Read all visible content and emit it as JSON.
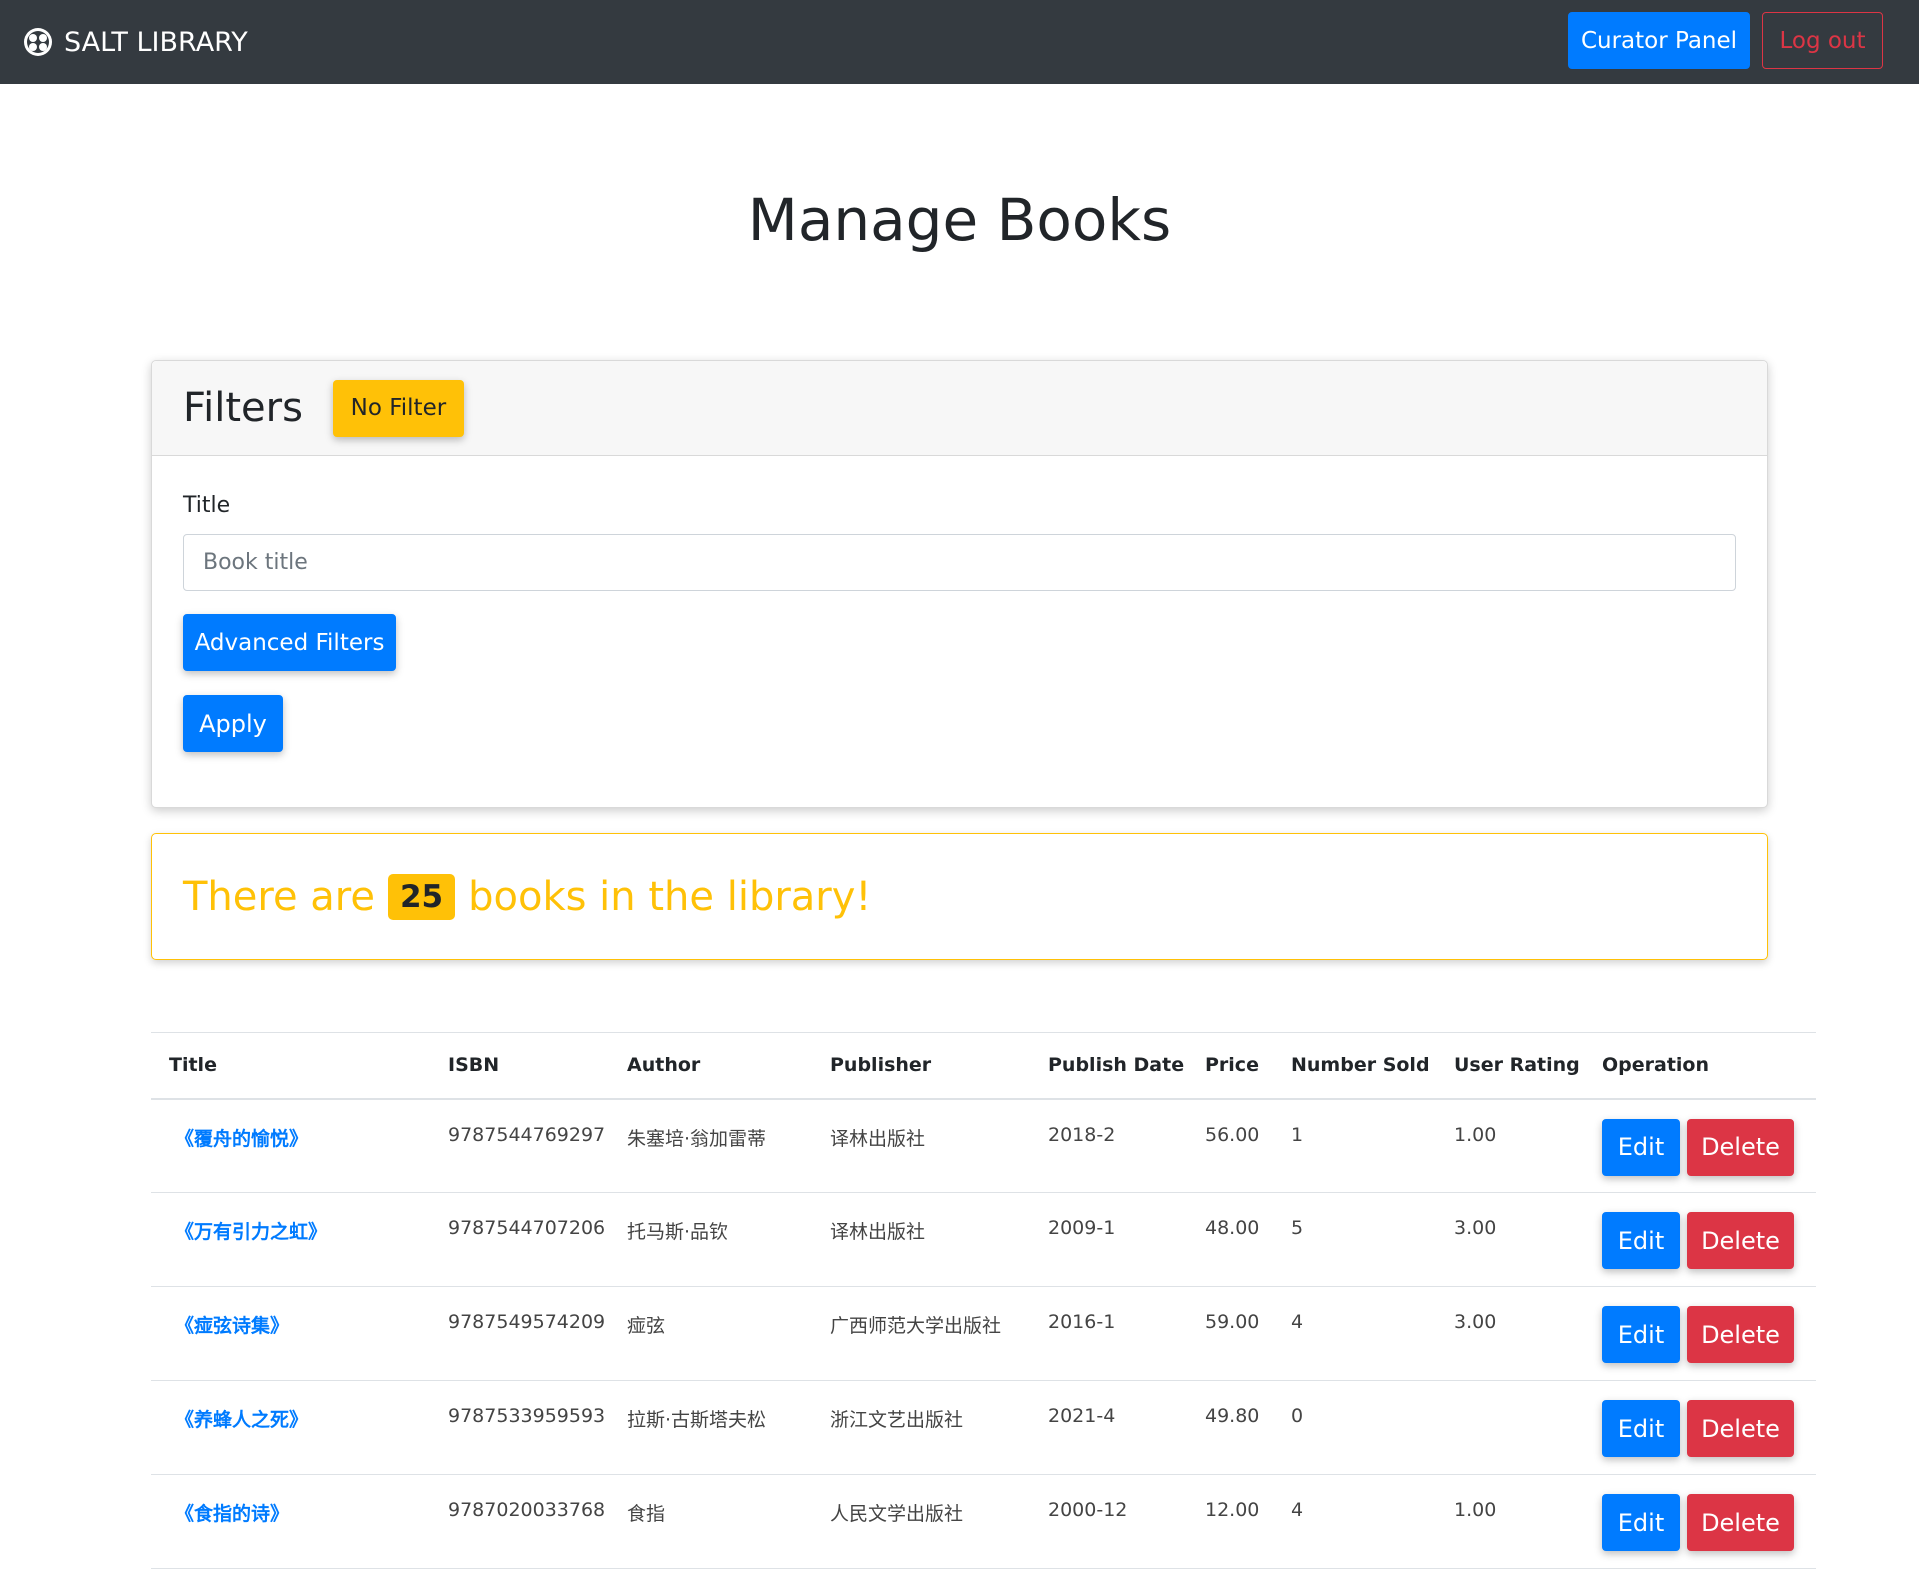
{
  "navbar": {
    "brand": "SALT LIBRARY",
    "curator_panel": "Curator Panel",
    "logout": "Log out"
  },
  "page": {
    "title": "Manage Books"
  },
  "filters": {
    "heading": "Filters",
    "no_filter": "No Filter",
    "title_label": "Title",
    "title_placeholder": "Book title",
    "advanced": "Advanced Filters",
    "apply": "Apply"
  },
  "summary": {
    "prefix": "There are",
    "count": "25",
    "suffix": "books in the library!"
  },
  "table": {
    "headers": [
      "Title",
      "ISBN",
      "Author",
      "Publisher",
      "Publish Date",
      "Price",
      "Number Sold",
      "User Rating",
      "Operation"
    ],
    "edit_label": "Edit",
    "delete_label": "Delete",
    "rows": [
      {
        "title": "《覆舟的愉悦》",
        "isbn": "9787544769297",
        "author": "朱塞培·翁加雷蒂",
        "publisher": "译林出版社",
        "date": "2018-2",
        "price": "56.00",
        "sold": "1",
        "rating": "1.00"
      },
      {
        "title": "《万有引力之虹》",
        "isbn": "9787544707206",
        "author": "托马斯·品钦",
        "publisher": "译林出版社",
        "date": "2009-1",
        "price": "48.00",
        "sold": "5",
        "rating": "3.00"
      },
      {
        "title": "《痖弦诗集》",
        "isbn": "9787549574209",
        "author": "痖弦",
        "publisher": "广西师范大学出版社",
        "date": "2016-1",
        "price": "59.00",
        "sold": "4",
        "rating": "3.00"
      },
      {
        "title": "《养蜂人之死》",
        "isbn": "9787533959593",
        "author": "拉斯·古斯塔夫松",
        "publisher": "浙江文艺出版社",
        "date": "2021-4",
        "price": "49.80",
        "sold": "0",
        "rating": ""
      },
      {
        "title": "《食指的诗》",
        "isbn": "9787020033768",
        "author": "食指",
        "publisher": "人民文学出版社",
        "date": "2000-12",
        "price": "12.00",
        "sold": "4",
        "rating": "1.00"
      }
    ]
  },
  "colors": {
    "navbar_bg": "#343a40",
    "primary": "#007bff",
    "danger": "#dc3545",
    "warning": "#ffc107"
  }
}
